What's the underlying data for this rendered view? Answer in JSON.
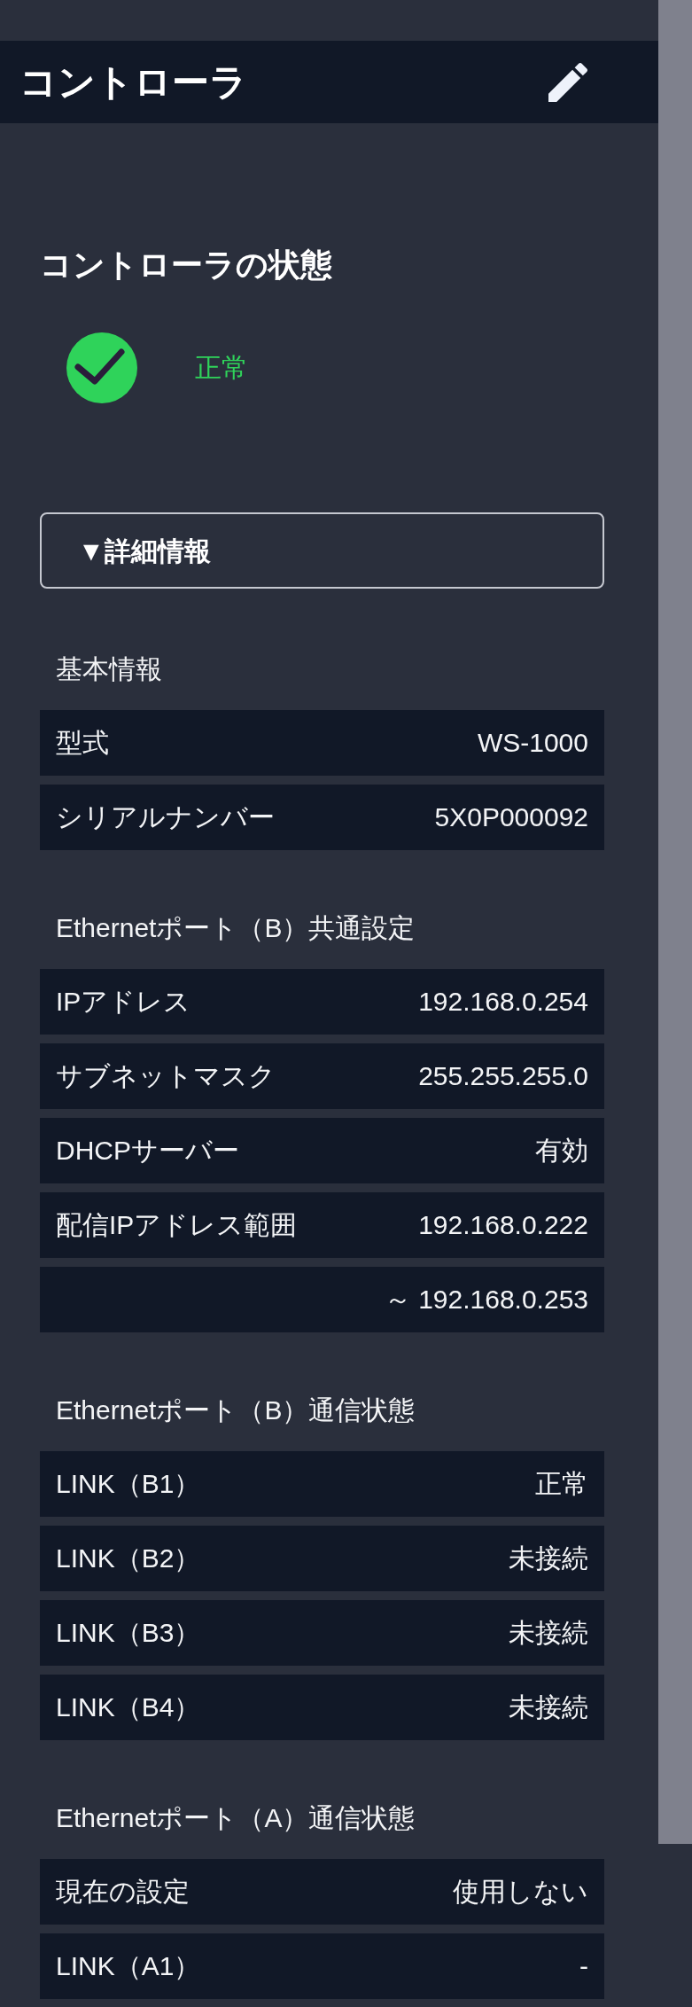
{
  "header": {
    "title": "コントローラ"
  },
  "status": {
    "heading": "コントローラの状態",
    "healthy": true,
    "label": "正常"
  },
  "details_toggle": {
    "label": "▼詳細情報"
  },
  "sections": [
    {
      "title": "基本情報",
      "rows": [
        {
          "label": "型式",
          "value": "WS-1000"
        },
        {
          "label": "シリアルナンバー",
          "value": "5X0P000092"
        }
      ]
    },
    {
      "title": "Ethernetポート（B）共通設定",
      "rows": [
        {
          "label": "IPアドレス",
          "value": "192.168.0.254"
        },
        {
          "label": "サブネットマスク",
          "value": "255.255.255.0"
        },
        {
          "label": "DHCPサーバー",
          "value": "有効"
        },
        {
          "label": "配信IPアドレス範囲",
          "value": "192.168.0.222"
        },
        {
          "value": "～ 192.168.0.253"
        }
      ]
    },
    {
      "title": "Ethernetポート（B）通信状態",
      "rows": [
        {
          "label": "LINK（B1）",
          "value": "正常"
        },
        {
          "label": "LINK（B2）",
          "value": "未接続"
        },
        {
          "label": "LINK（B3）",
          "value": "未接続"
        },
        {
          "label": "LINK（B4）",
          "value": "未接続"
        }
      ]
    },
    {
      "title": "Ethernetポート（A）通信状態",
      "rows": [
        {
          "label": "現在の設定",
          "value": "使用しない"
        },
        {
          "label": "LINK（A1）",
          "value": "-"
        }
      ]
    }
  ]
}
